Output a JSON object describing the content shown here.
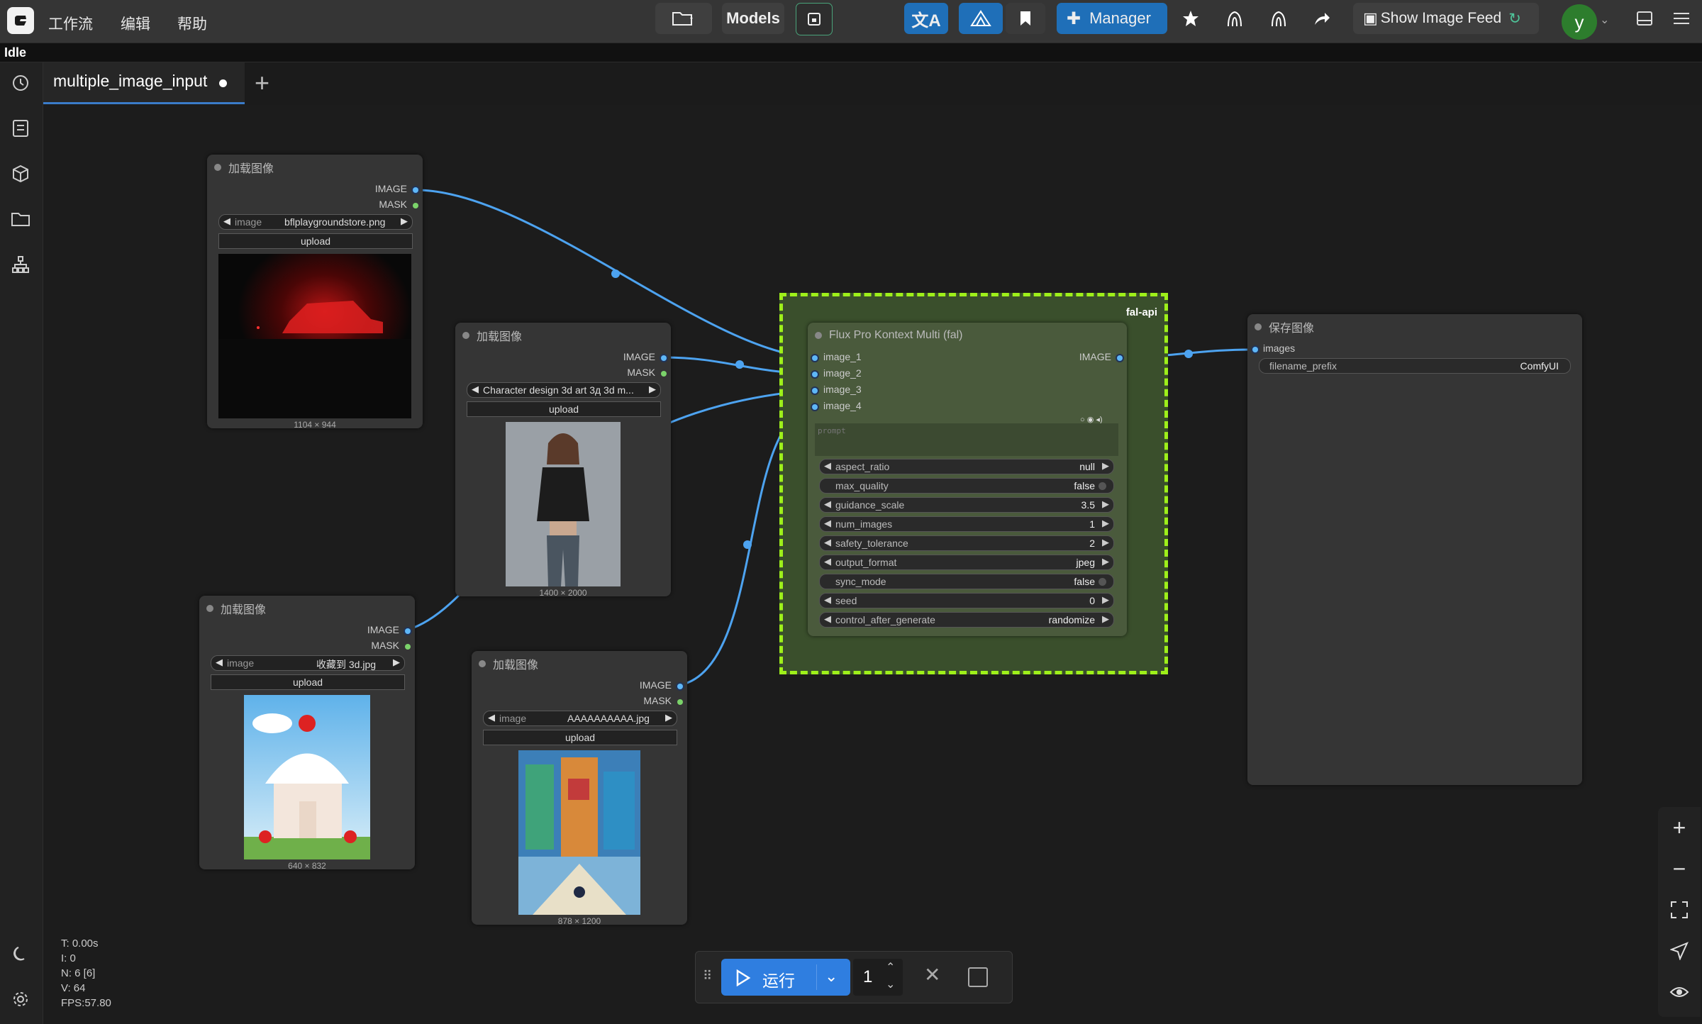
{
  "menubar": {
    "items": [
      "工作流",
      "编辑",
      "帮助"
    ],
    "models_label": "Models",
    "manager_label": "Manager",
    "image_feed_label": "Show Image Feed",
    "avatar_letter": "y"
  },
  "status": "Idle",
  "tabs": [
    {
      "label": "multiple_image_input",
      "modified": true
    }
  ],
  "nodes": {
    "load1": {
      "title": "加载图像",
      "outputs": [
        "IMAGE",
        "MASK"
      ],
      "image_label": "image",
      "image_value": "bflplaygroundstore.png",
      "upload_label": "upload",
      "dims": "1104 × 944"
    },
    "load2": {
      "title": "加载图像",
      "outputs": [
        "IMAGE",
        "MASK"
      ],
      "image_label": "",
      "image_value": "Character design  3d art 3д 3d m...",
      "upload_label": "upload",
      "dims": "1400 × 2000"
    },
    "load3": {
      "title": "加载图像",
      "outputs": [
        "IMAGE",
        "MASK"
      ],
      "image_label": "image",
      "image_value": "收藏到 3d.jpg",
      "upload_label": "upload",
      "dims": "640 × 832"
    },
    "load4": {
      "title": "加载图像",
      "outputs": [
        "IMAGE",
        "MASK"
      ],
      "image_label": "image",
      "image_value": "AAAAAAAAAA.jpg",
      "upload_label": "upload",
      "dims": "878 × 1200"
    },
    "flux": {
      "group_title": "fal-api",
      "title": "Flux Pro Kontext Multi (fal)",
      "inputs": [
        "image_1",
        "image_2",
        "image_3",
        "image_4"
      ],
      "output": "IMAGE",
      "prompt_placeholder": "prompt",
      "widgets": [
        {
          "label": "aspect_ratio",
          "value": "null",
          "kind": "combo"
        },
        {
          "label": "max_quality",
          "value": "false",
          "kind": "toggle"
        },
        {
          "label": "guidance_scale",
          "value": "3.5",
          "kind": "number"
        },
        {
          "label": "num_images",
          "value": "1",
          "kind": "number"
        },
        {
          "label": "safety_tolerance",
          "value": "2",
          "kind": "combo"
        },
        {
          "label": "output_format",
          "value": "jpeg",
          "kind": "combo"
        },
        {
          "label": "sync_mode",
          "value": "false",
          "kind": "toggle"
        },
        {
          "label": "seed",
          "value": "0",
          "kind": "number"
        },
        {
          "label": "control_after_generate",
          "value": "randomize",
          "kind": "combo"
        }
      ]
    },
    "save": {
      "title": "保存图像",
      "input": "images",
      "prefix_label": "filename_prefix",
      "prefix_value": "ComfyUI"
    }
  },
  "perf": {
    "T": "T: 0.00s",
    "I": "I: 0",
    "N": "N: 6 [6]",
    "V": "V: 64",
    "FPS": "FPS:57.80"
  },
  "runbar": {
    "run_label": "运行",
    "batch_count": "1"
  },
  "colors": {
    "link": "#4da3f0",
    "group_border": "#9ef01a",
    "accent": "#2f7ee0"
  }
}
